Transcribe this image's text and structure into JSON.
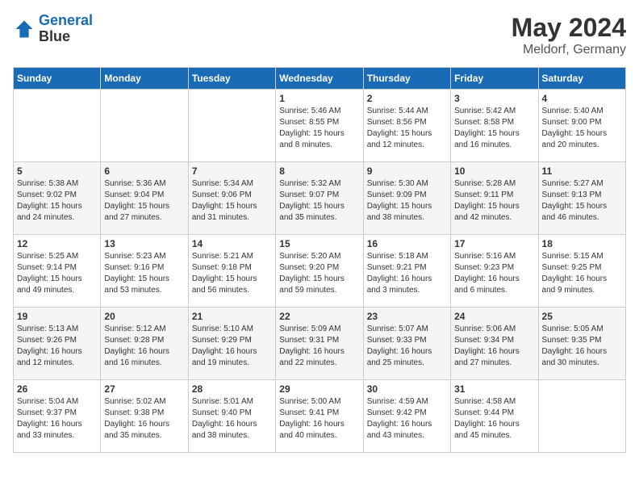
{
  "header": {
    "logo_line1": "General",
    "logo_line2": "Blue",
    "month_year": "May 2024",
    "location": "Meldorf, Germany"
  },
  "days_of_week": [
    "Sunday",
    "Monday",
    "Tuesday",
    "Wednesday",
    "Thursday",
    "Friday",
    "Saturday"
  ],
  "weeks": [
    [
      {
        "day": "",
        "info": ""
      },
      {
        "day": "",
        "info": ""
      },
      {
        "day": "",
        "info": ""
      },
      {
        "day": "1",
        "info": "Sunrise: 5:46 AM\nSunset: 8:55 PM\nDaylight: 15 hours\nand 8 minutes."
      },
      {
        "day": "2",
        "info": "Sunrise: 5:44 AM\nSunset: 8:56 PM\nDaylight: 15 hours\nand 12 minutes."
      },
      {
        "day": "3",
        "info": "Sunrise: 5:42 AM\nSunset: 8:58 PM\nDaylight: 15 hours\nand 16 minutes."
      },
      {
        "day": "4",
        "info": "Sunrise: 5:40 AM\nSunset: 9:00 PM\nDaylight: 15 hours\nand 20 minutes."
      }
    ],
    [
      {
        "day": "5",
        "info": "Sunrise: 5:38 AM\nSunset: 9:02 PM\nDaylight: 15 hours\nand 24 minutes."
      },
      {
        "day": "6",
        "info": "Sunrise: 5:36 AM\nSunset: 9:04 PM\nDaylight: 15 hours\nand 27 minutes."
      },
      {
        "day": "7",
        "info": "Sunrise: 5:34 AM\nSunset: 9:06 PM\nDaylight: 15 hours\nand 31 minutes."
      },
      {
        "day": "8",
        "info": "Sunrise: 5:32 AM\nSunset: 9:07 PM\nDaylight: 15 hours\nand 35 minutes."
      },
      {
        "day": "9",
        "info": "Sunrise: 5:30 AM\nSunset: 9:09 PM\nDaylight: 15 hours\nand 38 minutes."
      },
      {
        "day": "10",
        "info": "Sunrise: 5:28 AM\nSunset: 9:11 PM\nDaylight: 15 hours\nand 42 minutes."
      },
      {
        "day": "11",
        "info": "Sunrise: 5:27 AM\nSunset: 9:13 PM\nDaylight: 15 hours\nand 46 minutes."
      }
    ],
    [
      {
        "day": "12",
        "info": "Sunrise: 5:25 AM\nSunset: 9:14 PM\nDaylight: 15 hours\nand 49 minutes."
      },
      {
        "day": "13",
        "info": "Sunrise: 5:23 AM\nSunset: 9:16 PM\nDaylight: 15 hours\nand 53 minutes."
      },
      {
        "day": "14",
        "info": "Sunrise: 5:21 AM\nSunset: 9:18 PM\nDaylight: 15 hours\nand 56 minutes."
      },
      {
        "day": "15",
        "info": "Sunrise: 5:20 AM\nSunset: 9:20 PM\nDaylight: 15 hours\nand 59 minutes."
      },
      {
        "day": "16",
        "info": "Sunrise: 5:18 AM\nSunset: 9:21 PM\nDaylight: 16 hours\nand 3 minutes."
      },
      {
        "day": "17",
        "info": "Sunrise: 5:16 AM\nSunset: 9:23 PM\nDaylight: 16 hours\nand 6 minutes."
      },
      {
        "day": "18",
        "info": "Sunrise: 5:15 AM\nSunset: 9:25 PM\nDaylight: 16 hours\nand 9 minutes."
      }
    ],
    [
      {
        "day": "19",
        "info": "Sunrise: 5:13 AM\nSunset: 9:26 PM\nDaylight: 16 hours\nand 12 minutes."
      },
      {
        "day": "20",
        "info": "Sunrise: 5:12 AM\nSunset: 9:28 PM\nDaylight: 16 hours\nand 16 minutes."
      },
      {
        "day": "21",
        "info": "Sunrise: 5:10 AM\nSunset: 9:29 PM\nDaylight: 16 hours\nand 19 minutes."
      },
      {
        "day": "22",
        "info": "Sunrise: 5:09 AM\nSunset: 9:31 PM\nDaylight: 16 hours\nand 22 minutes."
      },
      {
        "day": "23",
        "info": "Sunrise: 5:07 AM\nSunset: 9:33 PM\nDaylight: 16 hours\nand 25 minutes."
      },
      {
        "day": "24",
        "info": "Sunrise: 5:06 AM\nSunset: 9:34 PM\nDaylight: 16 hours\nand 27 minutes."
      },
      {
        "day": "25",
        "info": "Sunrise: 5:05 AM\nSunset: 9:35 PM\nDaylight: 16 hours\nand 30 minutes."
      }
    ],
    [
      {
        "day": "26",
        "info": "Sunrise: 5:04 AM\nSunset: 9:37 PM\nDaylight: 16 hours\nand 33 minutes."
      },
      {
        "day": "27",
        "info": "Sunrise: 5:02 AM\nSunset: 9:38 PM\nDaylight: 16 hours\nand 35 minutes."
      },
      {
        "day": "28",
        "info": "Sunrise: 5:01 AM\nSunset: 9:40 PM\nDaylight: 16 hours\nand 38 minutes."
      },
      {
        "day": "29",
        "info": "Sunrise: 5:00 AM\nSunset: 9:41 PM\nDaylight: 16 hours\nand 40 minutes."
      },
      {
        "day": "30",
        "info": "Sunrise: 4:59 AM\nSunset: 9:42 PM\nDaylight: 16 hours\nand 43 minutes."
      },
      {
        "day": "31",
        "info": "Sunrise: 4:58 AM\nSunset: 9:44 PM\nDaylight: 16 hours\nand 45 minutes."
      },
      {
        "day": "",
        "info": ""
      }
    ]
  ]
}
